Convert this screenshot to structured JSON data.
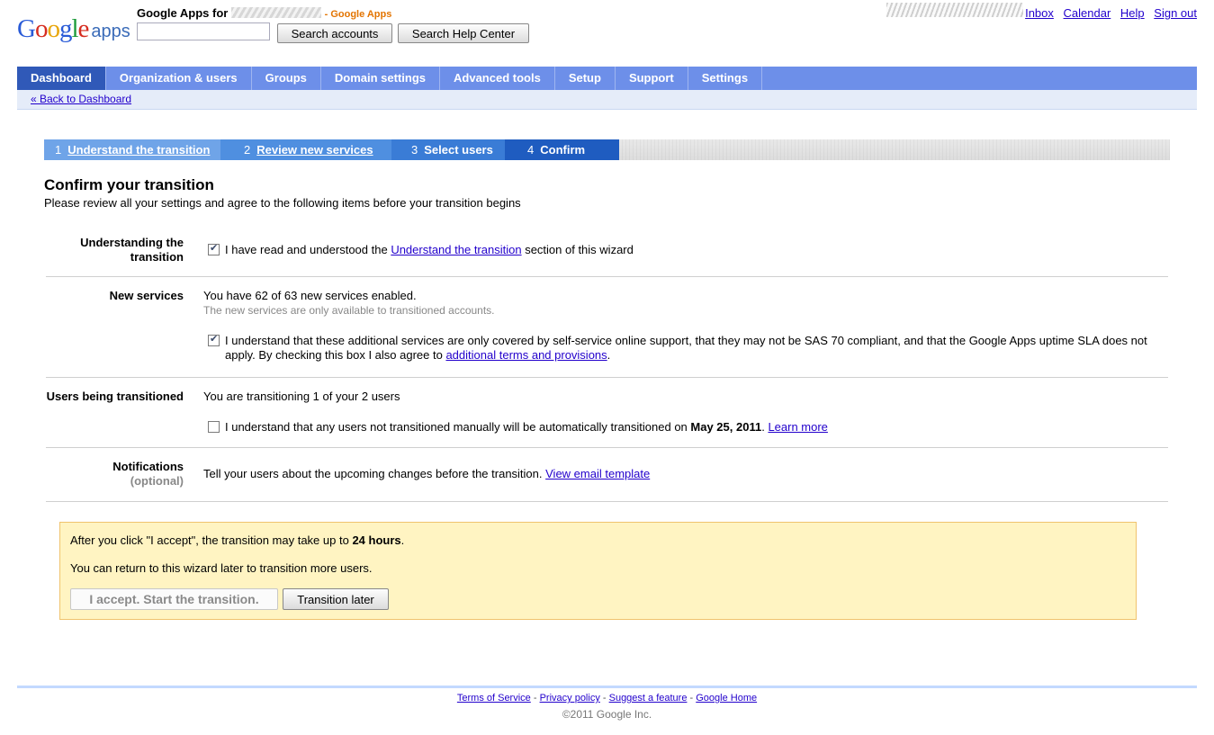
{
  "header": {
    "logo_google": "Google",
    "logo_apps": "apps",
    "domain_prefix": "Google Apps for",
    "domain_suffix": "- Google Apps",
    "search_accounts_label": "Search accounts",
    "search_help_label": "Search Help Center",
    "links": [
      "Inbox",
      "Calendar",
      "Help",
      "Sign out"
    ]
  },
  "nav": {
    "tabs": [
      "Dashboard",
      "Organization & users",
      "Groups",
      "Domain settings",
      "Advanced tools",
      "Setup",
      "Support",
      "Settings"
    ],
    "active": "Dashboard",
    "back_link": "« Back to Dashboard"
  },
  "wizard": {
    "steps": [
      {
        "num": "1",
        "label": "Understand the transition"
      },
      {
        "num": "2",
        "label": "Review new services"
      },
      {
        "num": "3",
        "label": "Select users"
      },
      {
        "num": "4",
        "label": "Confirm"
      }
    ],
    "current_step": 4
  },
  "main": {
    "title": "Confirm your transition",
    "subtitle": "Please review all your settings and agree to the following items before your transition begins",
    "sections": {
      "understanding": {
        "label": "Understanding the transition",
        "cb_pre": "I have read and understood the ",
        "cb_link": "Understand the transition",
        "cb_post": " section of this wizard",
        "checked": true
      },
      "new_services": {
        "label": "New services",
        "status": "You have 62 of 63 new services enabled.",
        "note": "The new services are only available to transitioned accounts.",
        "cb_pre": "I understand that these additional services are only covered by self-service online support, that they may not be SAS 70 compliant, and that the Google Apps uptime SLA does not apply. By checking this box I also agree to ",
        "cb_link": "additional terms and provisions",
        "cb_post": ".",
        "checked": true
      },
      "users": {
        "label": "Users being transitioned",
        "status": "You are transitioning 1 of your 2 users",
        "cb_pre": "I understand that any users not transitioned manually will be automatically transitioned on ",
        "cb_date": "May 25, 2011",
        "cb_post": ". ",
        "cb_link": "Learn more",
        "checked": false
      },
      "notifications": {
        "label": "Notifications",
        "optional": "(optional)",
        "text": "Tell your users about the upcoming changes before the transition. ",
        "link": "View email template"
      }
    }
  },
  "notice": {
    "line1_pre": "After you click \"I accept\", the transition may take up to ",
    "line1_bold": "24 hours",
    "line1_post": ".",
    "line2": "You can return to this wizard later to transition more users.",
    "accept_label": "I accept. Start the transition.",
    "later_label": "Transition later"
  },
  "footer": {
    "links": [
      "Terms of Service",
      "Privacy policy",
      "Suggest a feature",
      "Google Home"
    ],
    "separator": " - ",
    "copyright": "©2011 Google Inc."
  }
}
